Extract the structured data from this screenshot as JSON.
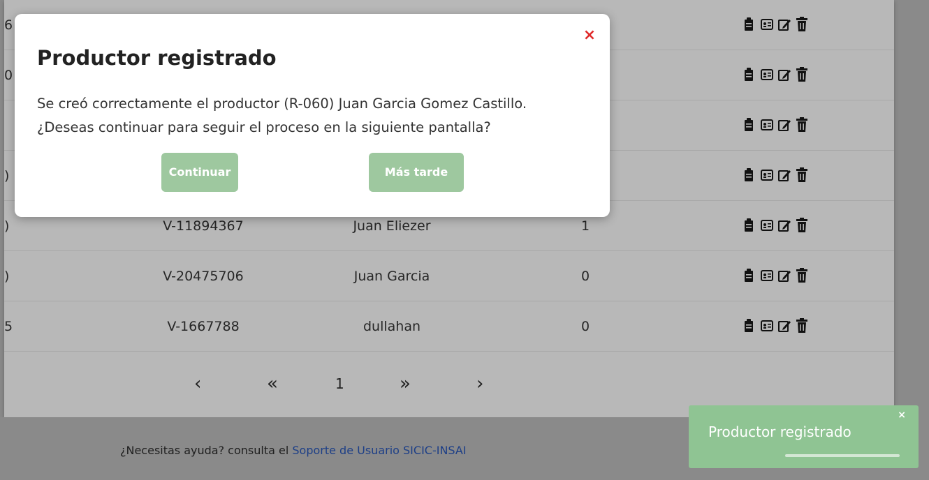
{
  "table": {
    "rows": [
      {
        "first": "6",
        "cedula": "",
        "name": "",
        "count": ""
      },
      {
        "first": "0",
        "cedula": "",
        "name": "",
        "count": ""
      },
      {
        "first": "",
        "cedula": "",
        "name": "",
        "count": ""
      },
      {
        "first": ")",
        "cedula": "",
        "name": "",
        "count": ""
      },
      {
        "first": ")",
        "cedula": "V-11894367",
        "name": "Juan Eliezer",
        "count": "1"
      },
      {
        "first": ")",
        "cedula": "V-20475706",
        "name": "Juan Garcia",
        "count": "0"
      },
      {
        "first": "5",
        "cedula": "V-1667788",
        "name": "dullahan",
        "count": "0"
      }
    ],
    "row_action_icons": [
      "clipboard-icon",
      "id-card-icon",
      "edit-icon",
      "trash-icon"
    ]
  },
  "pagination": {
    "prev": "‹",
    "first": "«",
    "page": "1",
    "last": "»",
    "next": "›"
  },
  "footer": {
    "help_text": "¿Necesitas ayuda? consulta el ",
    "help_link": "Soporte de Usuario SICIC-INSAI"
  },
  "modal": {
    "close": "×",
    "title": "Productor registrado",
    "line1": "Se creó correctamente el productor (R-060) Juan Garcia Gomez Castillo.",
    "line2": "¿Deseas continuar para seguir el proceso en la siguiente pantalla?",
    "continue_label": "Continuar",
    "later_label": "Más tarde"
  },
  "toast": {
    "close": "×",
    "text": "Productor registrado",
    "progress": 0.5
  },
  "colors": {
    "accent_green": "#9ec89f",
    "close_red": "#e02b2b",
    "link_blue": "#1d3f87"
  }
}
